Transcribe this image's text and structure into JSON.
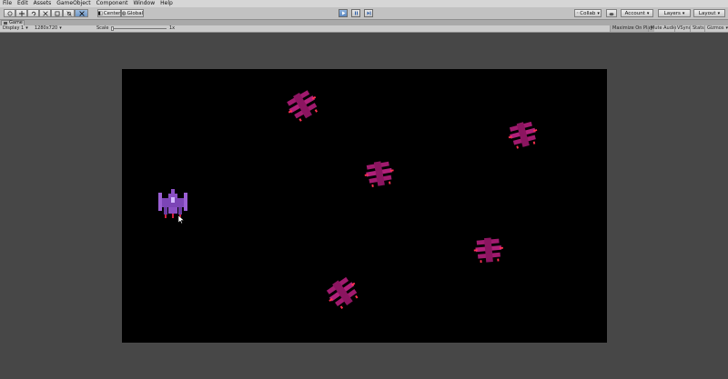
{
  "menu": [
    "File",
    "Edit",
    "Assets",
    "GameObject",
    "Component",
    "Window",
    "Help"
  ],
  "toolbar": {
    "tools": [
      "hand-tool",
      "move-tool",
      "rotate-tool",
      "scale-tool",
      "rect-tool",
      "transform-tool",
      "custom-tool"
    ],
    "pivot_label": "Center",
    "space_label": "Global",
    "collab_label": "Collab",
    "account_label": "Account",
    "layers_label": "Layers",
    "layout_label": "Layout"
  },
  "game_tab": {
    "label": "Game"
  },
  "game_toolbar": {
    "display": "Display 1",
    "resolution": "1280x720",
    "scale_label": "Scale",
    "scale_value": "1x",
    "maximize": "Maximize On Play",
    "mute": "Mute Audio",
    "vsync": "VSync",
    "stats": "Stats",
    "gizmos": "Gizmos"
  },
  "colors": {
    "player": "#8a4fc3",
    "enemy": "#a01a6e",
    "background": "#000000"
  }
}
